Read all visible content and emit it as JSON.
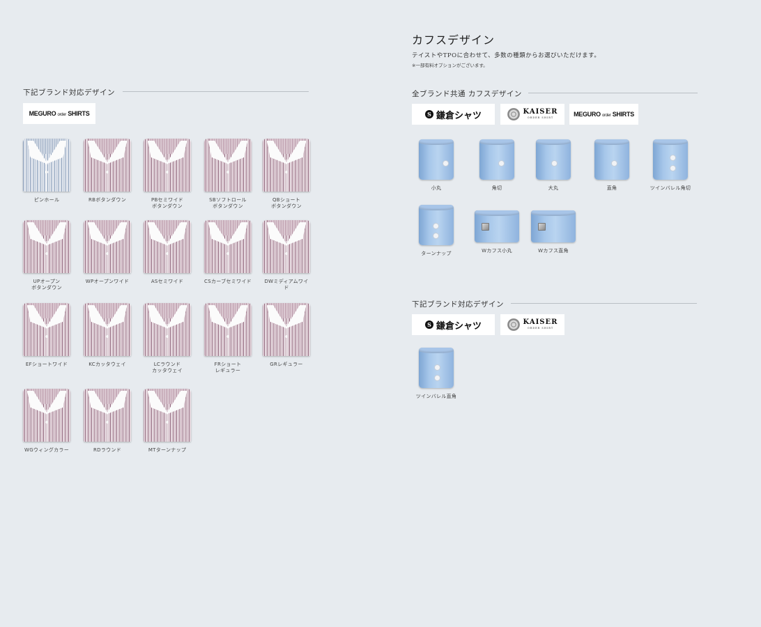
{
  "left": {
    "section_title": "下記ブランド対応デザイン",
    "brand_logo": {
      "meguro": "MEGURO",
      "order": "order",
      "shirts": "SHIRTS"
    },
    "collars": [
      {
        "label": "ピンホール",
        "color": "blue"
      },
      {
        "label": "RBボタンダウン"
      },
      {
        "label": "PBセミワイド\nボタンダウン"
      },
      {
        "label": "SBソフトロール\nボタンダウン"
      },
      {
        "label": "QBショート\nボタンダウン"
      },
      {
        "label": "UPオープン\nボタンダウン"
      },
      {
        "label": "WPオープンワイド"
      },
      {
        "label": "ASセミワイド"
      },
      {
        "label": "CSカーブセミワイド"
      },
      {
        "label": "DWミディアムワイド"
      },
      {
        "label": "EFショートワイド"
      },
      {
        "label": "KCカッタウェイ"
      },
      {
        "label": "LCラウンド\nカッタウェイ"
      },
      {
        "label": "FRショート\nレギュラー"
      },
      {
        "label": "GRレギュラー"
      },
      {
        "label": "WGウィングカラー"
      },
      {
        "label": "RDラウンド"
      },
      {
        "label": "MTターンナップ"
      }
    ]
  },
  "right": {
    "heading": "カフスデザイン",
    "description": "テイストやTPOに合わせて、多数の種類からお選びいただけます。",
    "note": "※一部有料オプションがございます。",
    "common_section_title": "全ブランド共通 カフスデザイン",
    "brand_section_title": "下記ブランド対応デザイン",
    "brands": {
      "kamakura": "鎌倉シャツ",
      "kaiser_name": "KAISER",
      "kaiser_sub": "ORDER SHIRT",
      "meguro": "MEGURO",
      "order": "order",
      "shirts": "SHIRTS"
    },
    "common_cuffs": [
      {
        "label": "小丸"
      },
      {
        "label": "角切"
      },
      {
        "label": "大丸"
      },
      {
        "label": "直角"
      },
      {
        "label": "ツインバレル角切"
      },
      {
        "label": "ターンナップ"
      },
      {
        "label": "Wカフス小丸"
      },
      {
        "label": "Wカフス直角"
      }
    ],
    "brand_cuffs": [
      {
        "label": "ツインバレル直角"
      }
    ]
  }
}
